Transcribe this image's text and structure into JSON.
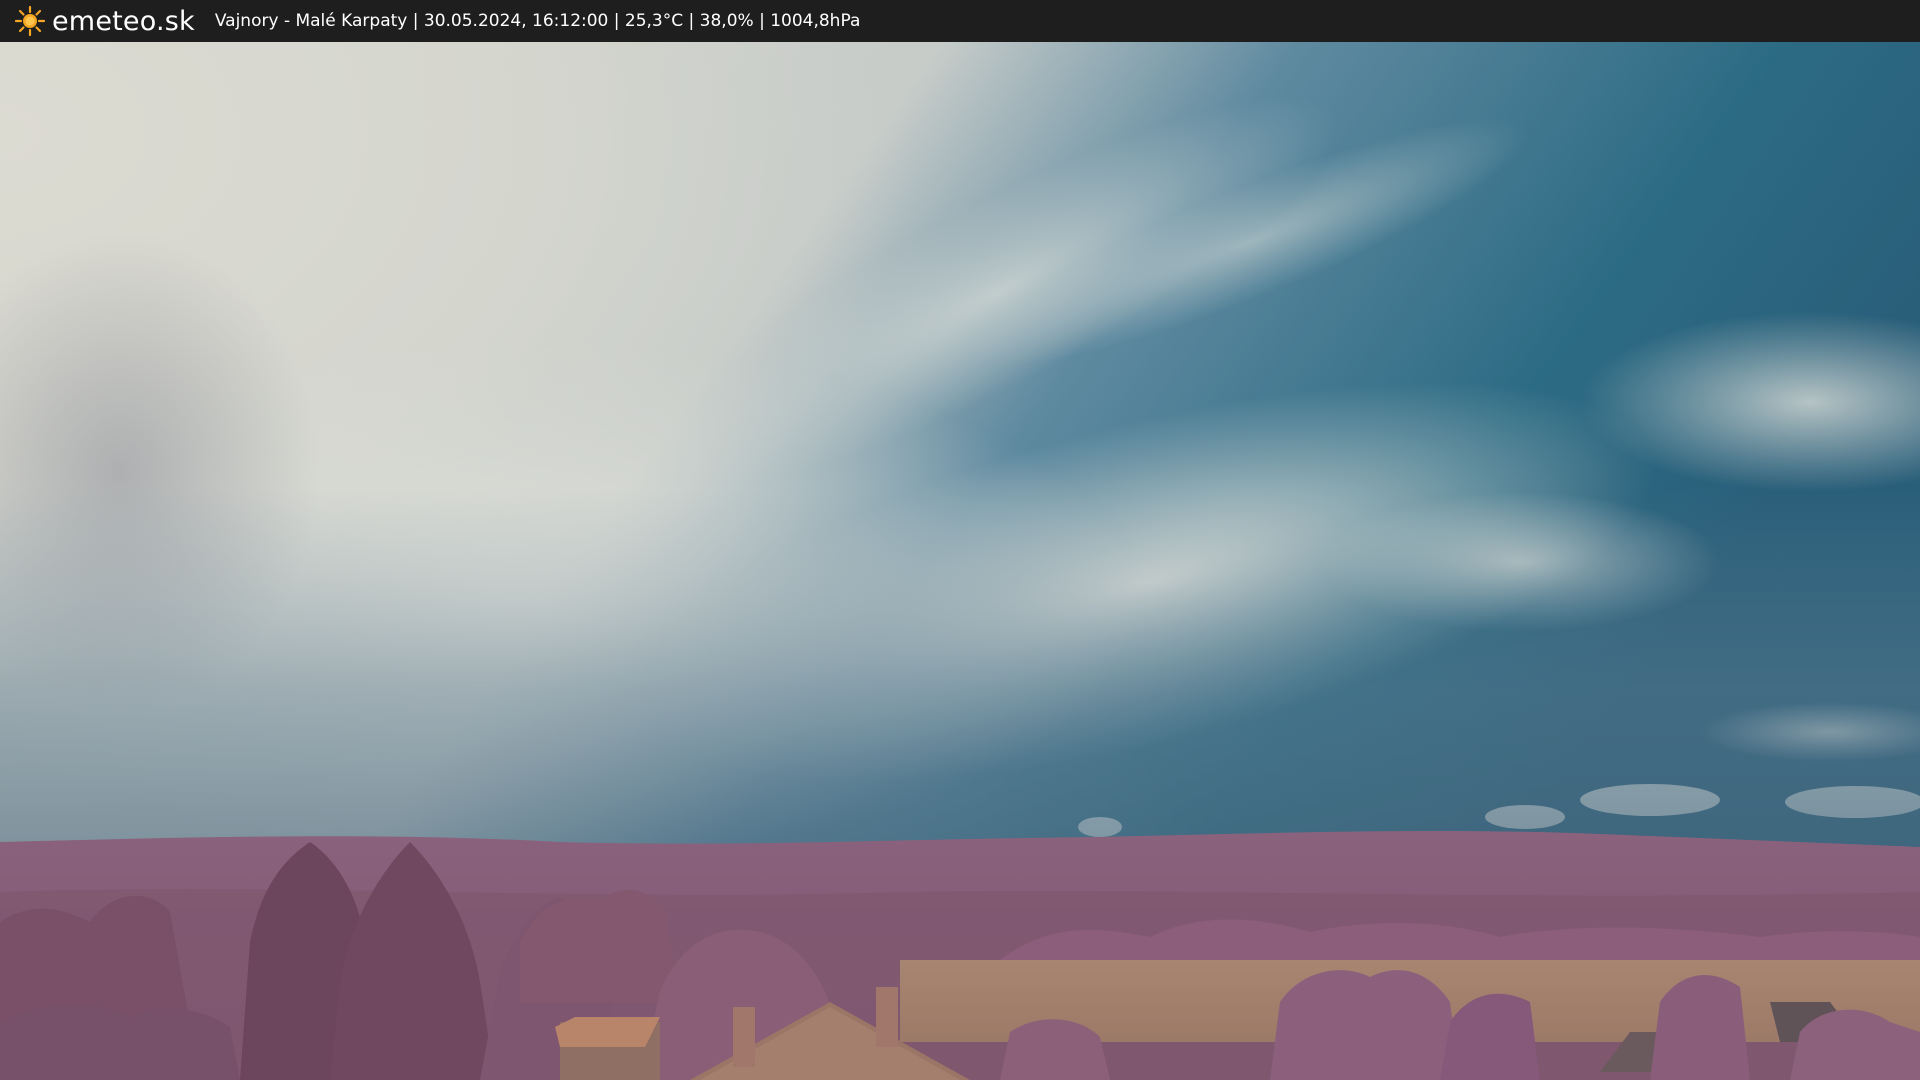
{
  "header": {
    "brand": "emeteo.sk",
    "brand_icon": "sun-icon",
    "caption": "Vajnory - Malé Karpaty | 30.05.2024, 16:12:00 | 25,3°C | 38,0% | 1004,8hPa"
  },
  "colors": {
    "bar": "#1e1e1e",
    "sun": "#f5a623",
    "sky_blue": "#2f6f86",
    "cloud": "#dcdcd2",
    "foliage": "#8e5f7c",
    "field": "#a6846e"
  }
}
